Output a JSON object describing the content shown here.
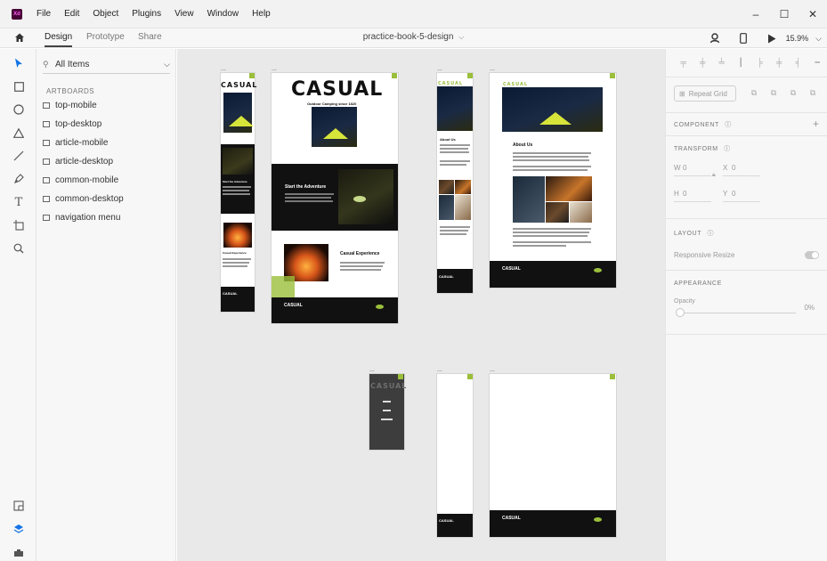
{
  "menubar": {
    "logo": "Xd",
    "items": [
      "File",
      "Edit",
      "Object",
      "Plugins",
      "View",
      "Window",
      "Help"
    ],
    "window_controls": [
      "–",
      "☐",
      "✕"
    ]
  },
  "tabs": {
    "design": "Design",
    "prototype": "Prototype",
    "share": "Share",
    "document_title": "practice-book-5-design",
    "zoom": "15.9%"
  },
  "layers": {
    "filter_label": "All Items",
    "section_title": "ARTBOARDS",
    "artboards": [
      "top-mobile",
      "top-desktop",
      "article-mobile",
      "article-desktop",
      "common-mobile",
      "common-desktop",
      "navigation menu"
    ]
  },
  "canvas": {
    "dots": "...",
    "brand": "CASUAL",
    "hero_subtitle": "Outdoor Camping since 1820",
    "adventure_title": "Start the Adventure",
    "experience_title": "Casual Experience",
    "about_title": "About Us",
    "accent_color": "#9bbf3b"
  },
  "properties": {
    "repeat_grid": "Repeat Grid",
    "component": "COMPONENT",
    "transform": "TRANSFORM",
    "w_label": "W",
    "w_value": "0",
    "x_label": "X",
    "x_value": "0",
    "h_label": "H",
    "h_value": "0",
    "y_label": "Y",
    "y_value": "0",
    "layout": "LAYOUT",
    "responsive_resize": "Responsive Resize",
    "appearance": "APPEARANCE",
    "opacity_label": "Opacity",
    "opacity_value": "0%"
  }
}
